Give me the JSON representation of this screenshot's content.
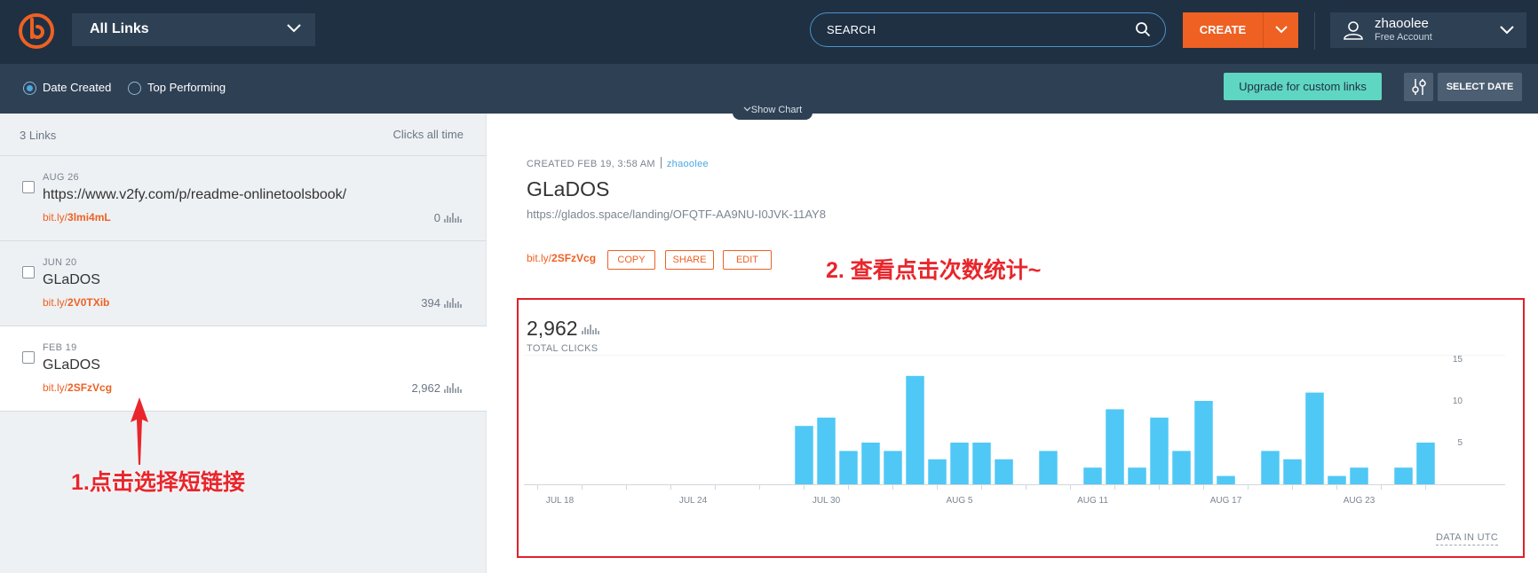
{
  "header": {
    "link_filter": "All Links",
    "search_placeholder": "SEARCH",
    "create_label": "CREATE",
    "user_name": "zhaoolee",
    "account_type": "Free Account"
  },
  "subbar": {
    "sort_options": [
      {
        "label": "Date Created",
        "selected": true
      },
      {
        "label": "Top Performing",
        "selected": false
      }
    ],
    "upgrade_label": "Upgrade for custom links",
    "select_date_label": "SELECT DATE",
    "show_chart_label": "Show Chart"
  },
  "list": {
    "count_label": "3 Links",
    "sort_label": "Clicks all time",
    "items": [
      {
        "date": "AUG 26",
        "title": "https://www.v2fy.com/p/readme-onlinetoolsbook/",
        "short_prefix": "bit.ly/",
        "short_code": "3lmi4mL",
        "clicks": "0",
        "selected": false
      },
      {
        "date": "JUN 20",
        "title": "GLaDOS",
        "short_prefix": "bit.ly/",
        "short_code": "2V0TXib",
        "clicks": "394",
        "selected": false
      },
      {
        "date": "FEB 19",
        "title": "GLaDOS",
        "short_prefix": "bit.ly/",
        "short_code": "2SFzVcg",
        "clicks": "2,962",
        "selected": true
      }
    ]
  },
  "annotations": {
    "step1": "1.点击选择短链接",
    "step2": "2. 查看点击次数统计~"
  },
  "detail": {
    "created_label": "CREATED FEB 19, 3:58 AM",
    "created_by": "zhaoolee",
    "title": "GLaDOS",
    "long_url": "https://glados.space/landing/OFQTF-AA9NU-I0JVK-11AY8",
    "short_prefix": "bit.ly/",
    "short_code": "2SFzVcg",
    "buttons": [
      "COPY",
      "SHARE",
      "EDIT"
    ],
    "total_clicks": "2,962",
    "total_clicks_label": "TOTAL CLICKS",
    "timezone_note": "DATA IN UTC"
  },
  "colors": {
    "accent": "#ee6123",
    "navy": "#1f3043",
    "bar": "#4fc8f5",
    "teal": "#5fd6c2",
    "annotation_red": "#e8262c"
  },
  "chart_data": {
    "type": "bar",
    "x_tick_labels": [
      "JUL 18",
      "JUL 24",
      "JUL 30",
      "AUG 5",
      "AUG 11",
      "AUG 17",
      "AUG 23"
    ],
    "y_tick_labels": [
      "5",
      "10",
      "15"
    ],
    "ylim": [
      0,
      16
    ],
    "grid": false,
    "days": 40,
    "values": [
      0,
      0,
      0,
      0,
      0,
      0,
      0,
      0,
      0,
      0,
      0,
      0,
      7,
      8,
      4,
      5,
      4,
      13,
      3,
      5,
      5,
      3,
      0,
      4,
      0,
      2,
      9,
      2,
      8,
      4,
      10,
      1,
      0,
      4,
      3,
      11,
      1,
      2,
      0,
      2,
      5
    ]
  }
}
